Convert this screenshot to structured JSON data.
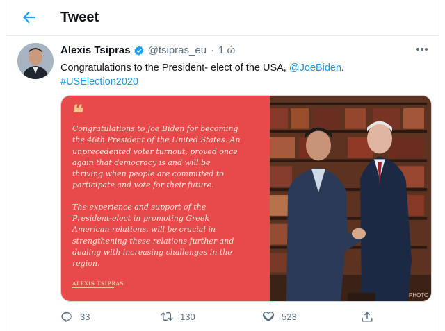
{
  "header": {
    "title": "Tweet",
    "back_icon": "back-arrow-icon"
  },
  "tweet": {
    "author_name": "Alexis Tsipras",
    "handle": "@tsipras_eu",
    "separator": "·",
    "time": "1 ώ",
    "text_prefix": "Congratulations to the President- elect of the USA, ",
    "mention": "@JoeBiden",
    "text_suffix": ".",
    "hashtag": "#USElection2020"
  },
  "media": {
    "quote_paragraph_1": "Congratulations to Joe Biden for becoming the 46th President of the United States. An unprecedented voter turnout, proved once again that democracy is and will be thriving when people are committed to participate and vote for their future.",
    "quote_paragraph_2": "The experience and support of the President-elect in promoting Greek American relations, will be crucial in strengthening these relations further and dealing with increasing challenges in the region.",
    "quote_signature": "ALEXIS TSIPRAS",
    "photo_watermark": "PHOTO"
  },
  "actions": {
    "replies": "33",
    "retweets": "130",
    "likes": "523"
  },
  "colors": {
    "accent": "#1da1f2",
    "quote_bg": "#e8494a",
    "link": "#1b95e0"
  }
}
